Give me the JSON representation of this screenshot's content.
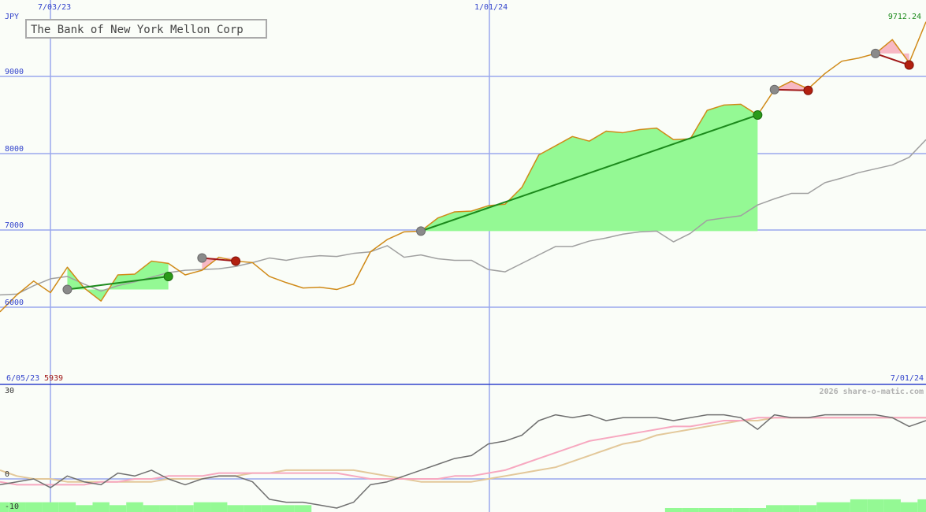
{
  "title": "The Bank of New York Mellon Corp",
  "currency": "JPY",
  "last_price": "9712.24",
  "date_start": "6/05/23",
  "start_price": "5939",
  "date_end": "7/01/24",
  "watermark": "2026 share-o-matic.com",
  "colors": {
    "price": "#d08a18",
    "benchmark": "#a0a0a0",
    "gain_fill": "#94f994",
    "loss_fill": "#f7b8c4",
    "buy_line": "#1c8a1c",
    "sell_line": "#a01818",
    "grid": "#9aa8ee",
    "axis_text": "#3344cc",
    "osc_main": "#707070",
    "osc_pink": "#f7a8c0",
    "osc_tan": "#e3c89a"
  },
  "chart_data": [
    {
      "type": "line",
      "name": "price",
      "x_labels": [
        "7/03/23",
        "1/01/24"
      ],
      "yticks": [
        6000,
        7000,
        8000,
        9000
      ],
      "ylim": [
        5850,
        9900
      ],
      "series": [
        {
          "name": "",
          "role": "price",
          "values": [
            5940,
            6160,
            6340,
            6190,
            6520,
            6250,
            6080,
            6420,
            6430,
            6600,
            6570,
            6420,
            6480,
            6650,
            6600,
            6580,
            6400,
            6320,
            6250,
            6260,
            6230,
            6300,
            6720,
            6880,
            6980,
            6990,
            7160,
            7240,
            7250,
            7320,
            7340,
            7560,
            7980,
            8100,
            8220,
            8160,
            8290,
            8270,
            8310,
            8330,
            8180,
            8190,
            8560,
            8630,
            8640,
            8500,
            8830,
            8940,
            8840,
            9040,
            9200,
            9240,
            9300,
            9480,
            9180,
            9712.24
          ]
        },
        {
          "name": "",
          "role": "benchmark",
          "values": [
            6160,
            6170,
            6280,
            6370,
            6400,
            6300,
            6210,
            6280,
            6330,
            6390,
            6450,
            6480,
            6490,
            6500,
            6530,
            6580,
            6640,
            6610,
            6650,
            6670,
            6660,
            6700,
            6720,
            6800,
            6650,
            6680,
            6630,
            6610,
            6610,
            6490,
            6460,
            6570,
            6680,
            6790,
            6790,
            6860,
            6900,
            6950,
            6980,
            6990,
            6850,
            6960,
            7130,
            7160,
            7190,
            7330,
            7410,
            7480,
            7480,
            7620,
            7680,
            7750,
            7800,
            7850,
            7950,
            8180
          ]
        }
      ],
      "trades": [
        {
          "type": "buy",
          "from_index": 4,
          "to_index": 10,
          "from_price": 6230,
          "to_price": 6400,
          "result": "gain"
        },
        {
          "type": "sell",
          "from_index": 12,
          "to_index": 14,
          "from_price": 6640,
          "to_price": 6600,
          "result": "loss"
        },
        {
          "type": "buy",
          "from_index": 25,
          "to_index": 45,
          "from_price": 6990,
          "to_price": 8500,
          "result": "gain"
        },
        {
          "type": "sell",
          "from_index": 46,
          "to_index": 48,
          "from_price": 8830,
          "to_price": 8820,
          "result": "loss"
        },
        {
          "type": "buy",
          "from_index": 52,
          "to_index": 54,
          "from_price": 9300,
          "to_price": 9150,
          "result": "loss"
        }
      ]
    },
    {
      "type": "line",
      "name": "oscillator",
      "yticks": [
        -10,
        0,
        30
      ],
      "ylim": [
        -14,
        32
      ],
      "series": [
        {
          "name": "",
          "role": "main",
          "values": [
            -2,
            -1,
            0,
            -3,
            1,
            -1,
            -2,
            2,
            1,
            3,
            0,
            -2,
            0,
            1,
            1,
            -1,
            -7,
            -8,
            -8,
            -9,
            -10,
            -8,
            -2,
            -1,
            1,
            3,
            5,
            7,
            8,
            12,
            13,
            15,
            20,
            22,
            21,
            22,
            20,
            21,
            21,
            21,
            20,
            21,
            22,
            22,
            21,
            17,
            22,
            21,
            21,
            22,
            22,
            22,
            22,
            21,
            18,
            20
          ]
        },
        {
          "name": "",
          "role": "signal",
          "values": [
            -1,
            -2,
            -2,
            -2,
            -2,
            -2,
            -1,
            -1,
            0,
            0,
            1,
            1,
            1,
            2,
            2,
            2,
            2,
            2,
            2,
            2,
            2,
            1,
            0,
            0,
            0,
            0,
            0,
            1,
            1,
            2,
            3,
            5,
            7,
            9,
            11,
            13,
            14,
            15,
            16,
            17,
            18,
            18,
            19,
            20,
            20,
            21,
            21,
            21,
            21,
            21,
            21,
            21,
            21,
            21,
            21,
            21
          ]
        },
        {
          "name": "",
          "role": "slow",
          "values": [
            3,
            1,
            0,
            0,
            -1,
            -1,
            -1,
            -1,
            -1,
            -1,
            0,
            0,
            0,
            1,
            1,
            2,
            2,
            3,
            3,
            3,
            3,
            3,
            2,
            1,
            0,
            -1,
            -1,
            -1,
            -1,
            0,
            1,
            2,
            3,
            4,
            6,
            8,
            10,
            12,
            13,
            15,
            16,
            17,
            18,
            19,
            20,
            20,
            21,
            21,
            21,
            21,
            21,
            21,
            21,
            21,
            21,
            21
          ]
        }
      ],
      "histogram": [
        -8,
        -8,
        -8,
        -8,
        -8,
        -9,
        -8,
        -9,
        -8,
        -9,
        -9,
        -9,
        -8,
        -8,
        -9,
        -9,
        -9,
        -9,
        -9,
        -10,
        -12,
        -12,
        -12,
        -12,
        -12,
        -12,
        -12,
        -12,
        -12,
        -12,
        -12,
        -12,
        -12,
        -12,
        -12,
        -12,
        -12,
        -12,
        -12,
        -12,
        -10,
        -10,
        -10,
        -10,
        -10,
        -10,
        -9,
        -9,
        -9,
        -8,
        -8,
        -7,
        -7,
        -7,
        -8,
        -7
      ]
    }
  ]
}
